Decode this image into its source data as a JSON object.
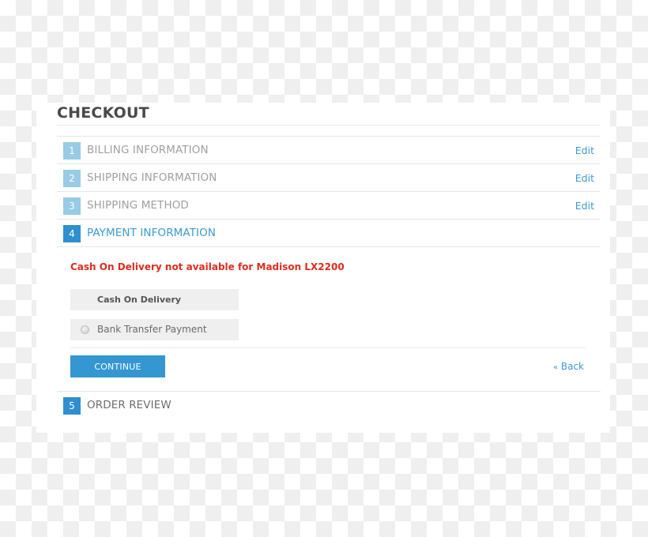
{
  "page": {
    "title": "CHECKOUT"
  },
  "steps": [
    {
      "number": "1",
      "label": "BILLING INFORMATION",
      "state": "completed",
      "action": "Edit"
    },
    {
      "number": "2",
      "label": "SHIPPING INFORMATION",
      "state": "completed",
      "action": "Edit"
    },
    {
      "number": "3",
      "label": "SHIPPING METHOD",
      "state": "completed",
      "action": "Edit"
    },
    {
      "number": "4",
      "label": "PAYMENT INFORMATION",
      "state": "active"
    },
    {
      "number": "5",
      "label": "ORDER REVIEW",
      "state": "pending"
    }
  ],
  "payment": {
    "error_message": "Cash On Delivery not available for Madison LX2200",
    "options": [
      {
        "label": "Cash On Delivery",
        "has_radio": false,
        "selected": false
      },
      {
        "label": "Bank Transfer Payment",
        "has_radio": true,
        "selected": false
      }
    ],
    "continue_label": "CONTINUE",
    "back_chevron": "«",
    "back_label": "Back"
  },
  "colors": {
    "accent": "#3497d2",
    "step_done": "#98cbe6",
    "error": "#dd2c1f",
    "option_bg": "#efefef"
  }
}
